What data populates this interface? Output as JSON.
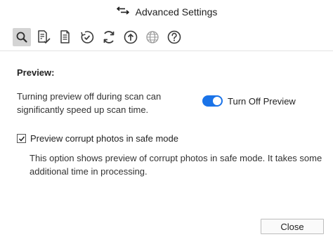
{
  "window": {
    "title": "Advanced Settings",
    "title_icon": "back-arrows-icon"
  },
  "toolbar": {
    "items": [
      {
        "icon": "search-icon",
        "active": true
      },
      {
        "icon": "document-edit-icon",
        "active": false
      },
      {
        "icon": "document-list-icon",
        "active": false
      },
      {
        "icon": "clock-check-icon",
        "active": false
      },
      {
        "icon": "refresh-icon",
        "active": false
      },
      {
        "icon": "upload-icon",
        "active": false
      },
      {
        "icon": "globe-icon",
        "active": false
      },
      {
        "icon": "help-icon",
        "active": false
      }
    ]
  },
  "preview": {
    "heading": "Preview:",
    "description": "Turning preview off during scan can significantly speed up scan time.",
    "toggle_label": "Turn Off Preview",
    "toggle_on": true
  },
  "corrupt_preview": {
    "label": "Preview corrupt photos in safe mode",
    "checked": true,
    "description": "This option shows preview of corrupt photos in safe mode. It takes some additional time in processing."
  },
  "footer": {
    "close_label": "Close"
  },
  "colors": {
    "accent": "#1a73e8",
    "active_tab_bg": "#d4d4d4",
    "icon": "#3a3a3a"
  }
}
